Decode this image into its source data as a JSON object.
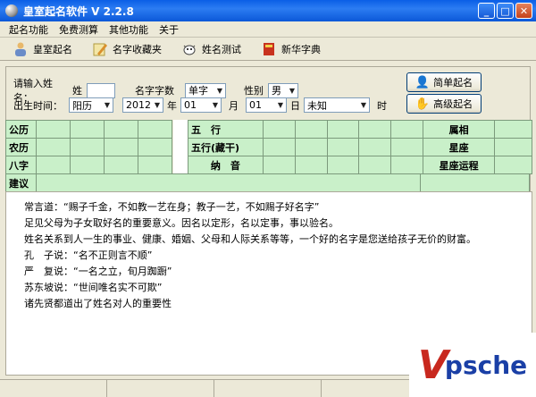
{
  "window": {
    "title": "皇室起名软件  V 2.2.8"
  },
  "menu": [
    "起名功能",
    "免费测算",
    "其他功能",
    "关于"
  ],
  "toolbar": [
    {
      "label": "皇室起名",
      "icon": "person-icon"
    },
    {
      "label": "名字收藏夹",
      "icon": "pencil-icon"
    },
    {
      "label": "姓名测试",
      "icon": "cow-icon"
    },
    {
      "label": "新华字典",
      "icon": "book-icon"
    }
  ],
  "form": {
    "name_prompt": "请输入姓名：",
    "surname_label": "姓",
    "surname_value": "",
    "char_count_label": "名字字数",
    "char_count_value": "单字",
    "gender_label": "性别",
    "gender_value": "男",
    "birth_label": "出生时间：",
    "calendar_value": "阳历",
    "year_value": "2012",
    "year_unit": "年",
    "month_value": "01",
    "month_unit": "月",
    "day_value": "01",
    "day_unit": "日",
    "hour_value": "未知",
    "hour_unit": "时"
  },
  "buttons": {
    "simple": "简单起名",
    "advanced": "高级起名"
  },
  "grid": {
    "left_rows": [
      "公历",
      "农历",
      "八字",
      "建议"
    ],
    "middle_rows": [
      "五　行",
      "五行(藏干)",
      "纳　音"
    ],
    "right_rows": [
      "属相",
      "星座",
      "星座运程"
    ]
  },
  "text_lines": [
    "常言道：“赐子千金，不如教一艺在身；教子一艺，不如赐子好名字”",
    "足见父母为子女取好名的重要意义。因名以定形，名以定事，事以验名。",
    "姓名关系到人一生的事业、健康、婚姻、父母和人际关系等等，一个好的名字是您送给孩子无价的财富。",
    "孔　子说：“名不正则言不顺”",
    "严　复说：“一名之立，旬月踟蹰”",
    "苏东坡说：“世间唯名实不可欺”",
    "诸先贤都道出了姓名对人的重要性"
  ],
  "logo": {
    "v": "V",
    "text": "psche"
  },
  "colors": {
    "grid_bg": "#c9f0c9",
    "title_bar": "#0a5fe6",
    "logo_red": "#c8281e",
    "logo_blue": "#1a3fa6"
  }
}
